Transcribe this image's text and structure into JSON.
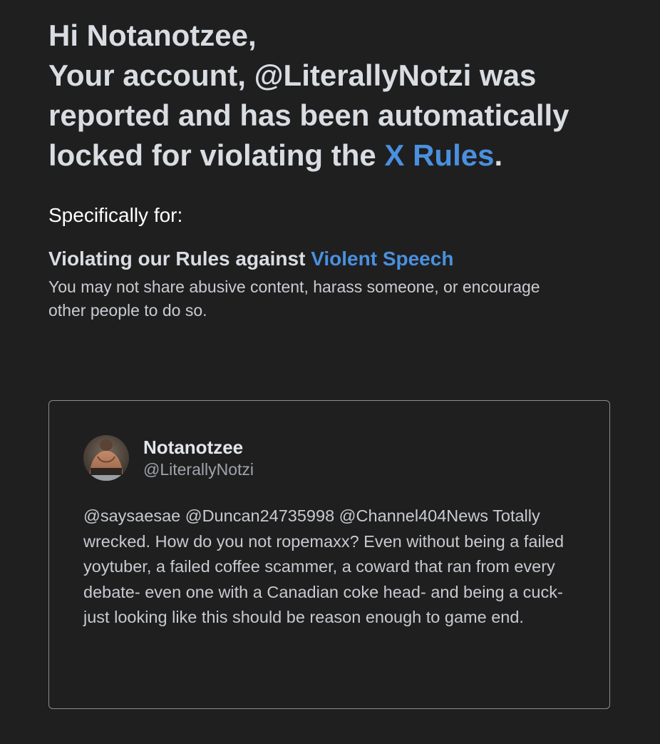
{
  "heading": {
    "greeting": "Hi Notanotzee,",
    "line_prefix": "Your account, @LiterallyNotzi was reported and has been automatically locked for violating the ",
    "rules_link": "X Rules",
    "line_suffix": "."
  },
  "specifically_label": "Specifically for:",
  "rule": {
    "title_prefix": "Violating our Rules against ",
    "title_link": "Violent Speech",
    "description": "You may not share abusive content, harass someone, or encourage other people to do so."
  },
  "tweet": {
    "display_name": "Notanotzee",
    "handle": "@LiterallyNotzi",
    "avatar_icon": "profile-photo",
    "text": "@saysaesae @Duncan24735998 @Channel404News Totally wrecked. How do you not ropemaxx? Even without being a failed yoytuber, a failed coffee scammer, a coward that ran from every debate- even one with a Canadian coke head- and being a cuck- just looking like this should be reason enough to game end."
  },
  "colors": {
    "background": "#1f1f20",
    "link": "#4a90de",
    "heading_text": "#d9dde2",
    "card_border": "#8a8d92"
  }
}
